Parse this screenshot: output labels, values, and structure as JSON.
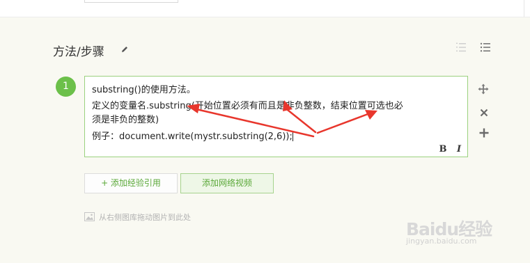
{
  "section": {
    "title": "方法/步骤"
  },
  "step": {
    "number": "1",
    "lines": [
      "substring()的使用方法。",
      "定义的变量名.substring(开始位置必须有而且是非负整数，结束位置可选也必",
      "须是非负的整数)",
      "例子：document.write(mystr.substring(2,6));"
    ],
    "format": {
      "bold": "B",
      "italic": "I"
    }
  },
  "buttons": {
    "add_reference": "+ 添加经验引用",
    "add_video": "添加网络视频"
  },
  "hint": "从右侧图库拖动图片到此处",
  "watermark": {
    "logo": "Baidu经验",
    "url": "jingyan.baidu.com"
  },
  "icons": [
    "pencil-icon",
    "ordered-list-icon",
    "unordered-list-icon",
    "move-icon",
    "close-icon",
    "plus-icon",
    "image-icon"
  ],
  "colors": {
    "accent": "#6cc04a",
    "editor_border": "#9ad17e",
    "annotation": "#e8362c"
  }
}
